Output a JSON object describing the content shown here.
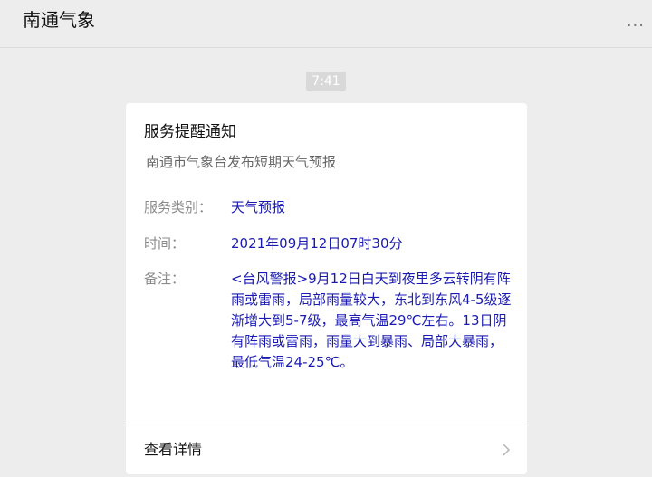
{
  "header": {
    "title": "南通气象",
    "more_label": "..."
  },
  "message": {
    "time": "7:41",
    "card": {
      "title": "服务提醒通知",
      "subtitle": "南通市气象台发布短期天气预报",
      "fields": [
        {
          "label": "服务类别：",
          "value": "天气预报"
        },
        {
          "label": "时间：",
          "value": "2021年09月12日07时30分"
        },
        {
          "label": "备注：",
          "value": "<台风警报>9月12日白天到夜里多云转阴有阵雨或雷雨，局部雨量较大，东北到东风4-5级逐渐增大到5-7级，最高气温29℃左右。13日阴有阵雨或雷雨，雨量大到暴雨、局部大暴雨，最低气温24-25℃。"
        }
      ],
      "detail_label": "查看详情"
    }
  },
  "colors": {
    "background": "#ededed",
    "value_text": "#1a1ab2",
    "label_text": "#8a8a8a"
  }
}
